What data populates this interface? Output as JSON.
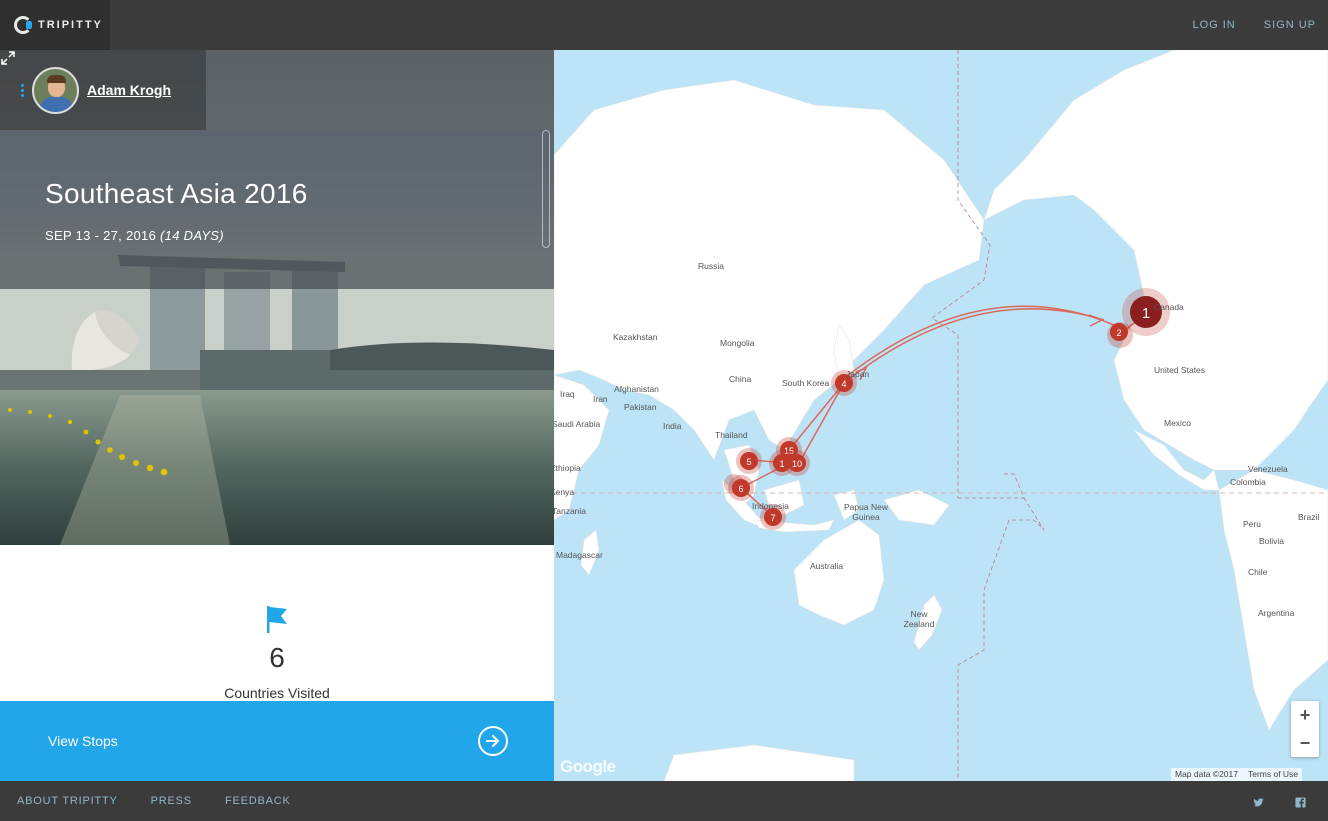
{
  "header": {
    "logo_text": "TRIPITTY",
    "login_label": "LOG IN",
    "signup_label": "SIGN UP"
  },
  "profile": {
    "name": "Adam Krogh"
  },
  "trip": {
    "title": "Southeast Asia 2016",
    "dates": "SEP 13 - 27, 2016",
    "duration": "(14 DAYS)"
  },
  "stats": {
    "countries_visited_value": "6",
    "countries_visited_label": "Countries Visited"
  },
  "cta": {
    "view_stops_label": "View Stops"
  },
  "map": {
    "labels": {
      "russia": "Russia",
      "kazakhstan": "Kazakhstan",
      "mongolia": "Mongolia",
      "china": "China",
      "south_korea": "South Korea",
      "japan": "Japan",
      "afghanistan": "Afghanistan",
      "iraq": "Iraq",
      "iran": "Iran",
      "pakistan": "Pakistan",
      "saudi_arabia": "Saudi Arabia",
      "india": "India",
      "thailand": "Thailand",
      "ethiopia": "Ethiopia",
      "kenya": "Kenya",
      "tanzania": "Tanzania",
      "madagascar": "Madagascar",
      "indonesia": "Indonesia",
      "papua_new_guinea": "Papua New Guinea",
      "australia": "Australia",
      "new_zealand": "New Zealand",
      "canada": "Canada",
      "united_states": "United States",
      "mexico": "Mexico",
      "venezuela": "Venezuela",
      "colombia": "Colombia",
      "peru": "Peru",
      "brazil": "Brazil",
      "bolivia": "Bolivia",
      "chile": "Chile",
      "argentina": "Argentina"
    },
    "markers": [
      "1",
      "2",
      "4",
      "5",
      "6",
      "7",
      "10",
      "15",
      "1"
    ],
    "zoom_in": "+",
    "zoom_out": "−",
    "google": "Google",
    "map_data": "Map data ©2017",
    "terms": "Terms of Use",
    "colors": {
      "water": "#bde3f7",
      "land": "#ffffff",
      "marker": "#c0392b",
      "route": "#d96a5e",
      "accent": "#22a6ea"
    }
  },
  "footer": {
    "about": "ABOUT TRIPITTY",
    "press": "PRESS",
    "feedback": "FEEDBACK",
    "icons": [
      "twitter-icon",
      "facebook-icon"
    ]
  }
}
